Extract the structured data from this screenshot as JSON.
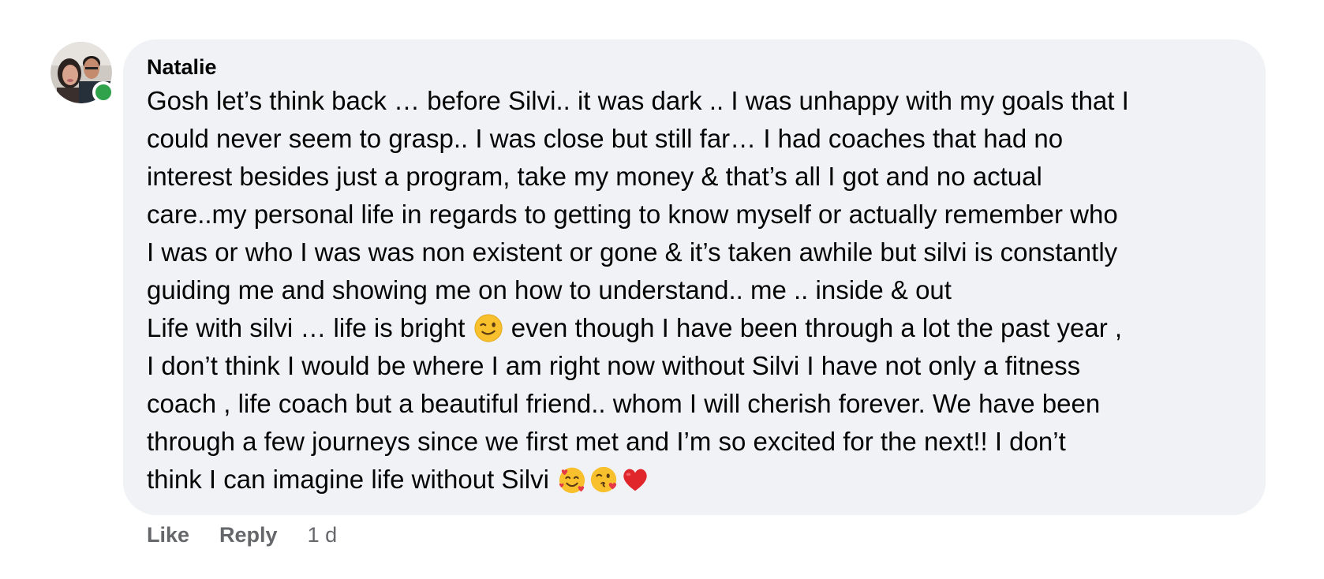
{
  "comment": {
    "author": "Natalie",
    "online": true,
    "lines": [
      "Gosh let’s think back … before Silvi.. it was dark .. I was unhappy with my goals that I",
      "could never seem to grasp.. I was close but still far… I had coaches that had no",
      "interest besides just a program, take my money & that’s all I got and no actual",
      "care..my personal life in regards to getting to know myself or actually remember who",
      "I was or who I was was non existent or gone & it’s taken awhile but silvi is constantly",
      "guiding me and showing me on how to understand.. me .. inside & out"
    ],
    "line7_before_emoji": "Life with silvi … life is bright",
    "line7_after_emoji": " even though I have been through a lot the past year ,",
    "lines_after": [
      "I don’t think I would be where I am right now without Silvi I have not only a fitness",
      "coach , life coach but a beautiful friend.. whom I will cherish forever. We have been",
      "through a few journeys since we first met and I’m so excited for the next!! I don’t"
    ],
    "last_line": "think I can imagine life without Silvi ",
    "emojis": [
      "winking-face-emoji",
      "smiling-face-with-hearts-emoji",
      "face-blowing-kiss-emoji",
      "red-heart-emoji"
    ]
  },
  "actions": {
    "like_label": "Like",
    "reply_label": "Reply",
    "timestamp": "1 d"
  },
  "colors": {
    "bubble_bg": "#f0f2f5",
    "text": "#050505",
    "secondary_text": "#65676b",
    "online": "#31a24c"
  }
}
